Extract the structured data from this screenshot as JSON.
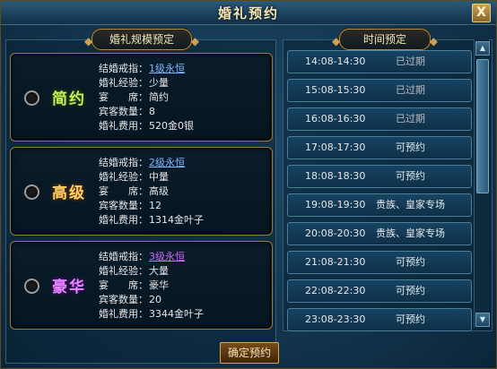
{
  "window": {
    "title": "婚礼预约",
    "close_label": "X"
  },
  "left": {
    "header": "婚礼规模预定",
    "options": [
      {
        "tier": "简约",
        "fields": [
          {
            "key": "结婚戒指：",
            "value": "1级永恒",
            "link": true
          },
          {
            "key": "婚礼经验：",
            "value": "少量"
          },
          {
            "key": "宴　　席：",
            "value": "简约"
          },
          {
            "key": "宾客数量：",
            "value": "8"
          },
          {
            "key": "婚礼费用：",
            "value": "520金0银"
          }
        ]
      },
      {
        "tier": "高级",
        "fields": [
          {
            "key": "结婚戒指：",
            "value": "2级永恒",
            "link": true
          },
          {
            "key": "婚礼经验：",
            "value": "中量"
          },
          {
            "key": "宴　　席：",
            "value": "高级"
          },
          {
            "key": "宾客数量：",
            "value": "12"
          },
          {
            "key": "婚礼费用：",
            "value": "1314金叶子"
          }
        ]
      },
      {
        "tier": "豪华",
        "fields": [
          {
            "key": "结婚戒指：",
            "value": "3级永恒",
            "link": true
          },
          {
            "key": "婚礼经验：",
            "value": "大量"
          },
          {
            "key": "宴　　席：",
            "value": "豪华"
          },
          {
            "key": "宾客数量：",
            "value": "20"
          },
          {
            "key": "婚礼费用：",
            "value": "3344金叶子"
          }
        ]
      }
    ]
  },
  "right": {
    "header": "时间预定",
    "slots": [
      {
        "time": "14:08-14:30",
        "status": "已过期"
      },
      {
        "time": "15:08-15:30",
        "status": "已过期"
      },
      {
        "time": "16:08-16:30",
        "status": "已过期"
      },
      {
        "time": "17:08-17:30",
        "status": "可预约"
      },
      {
        "time": "18:08-18:30",
        "status": "可预约"
      },
      {
        "time": "19:08-19:30",
        "status": "贵族、皇家专场"
      },
      {
        "time": "20:08-20:30",
        "status": "贵族、皇家专场"
      },
      {
        "time": "21:08-21:30",
        "status": "可预约"
      },
      {
        "time": "22:08-22:30",
        "status": "可预约"
      },
      {
        "time": "23:08-23:30",
        "status": "可预约"
      }
    ]
  },
  "confirm_label": "确定预约",
  "colors": {
    "link_blue": "#7fb9ff",
    "link_purple": "#d46aff",
    "frame_gold": "#b48d44"
  }
}
